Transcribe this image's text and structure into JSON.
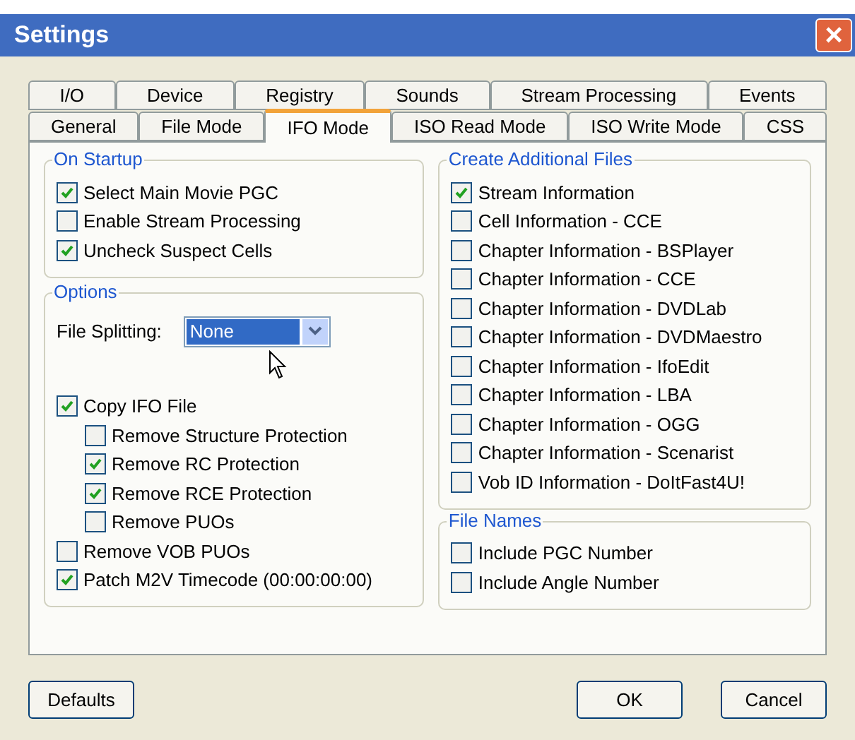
{
  "window": {
    "title": "Settings",
    "close": "×"
  },
  "tab_rows": [
    [
      {
        "label": "I/O",
        "selected": false
      },
      {
        "label": "Device",
        "selected": false
      },
      {
        "label": "Registry",
        "selected": false
      },
      {
        "label": "Sounds",
        "selected": false
      },
      {
        "label": "Stream Processing",
        "selected": false
      },
      {
        "label": "Events",
        "selected": false
      }
    ],
    [
      {
        "label": "General",
        "selected": false
      },
      {
        "label": "File Mode",
        "selected": false
      },
      {
        "label": "IFO Mode",
        "selected": true
      },
      {
        "label": "ISO Read Mode",
        "selected": false
      },
      {
        "label": "ISO Write Mode",
        "selected": false
      },
      {
        "label": "CSS",
        "selected": false
      }
    ]
  ],
  "on_startup": {
    "title": "On Startup",
    "items": [
      {
        "label": "Select Main Movie PGC",
        "checked": true
      },
      {
        "label": "Enable Stream Processing",
        "checked": false
      },
      {
        "label": "Uncheck Suspect Cells",
        "checked": true
      }
    ]
  },
  "options": {
    "title": "Options",
    "file_splitting": {
      "label": "File Splitting:",
      "value": "None"
    },
    "items": [
      {
        "label": "Copy IFO File",
        "checked": true,
        "children": [
          {
            "label": "Remove Structure Protection",
            "checked": false
          },
          {
            "label": "Remove RC Protection",
            "checked": true
          },
          {
            "label": "Remove RCE Protection",
            "checked": true
          },
          {
            "label": "Remove PUOs",
            "checked": false
          }
        ]
      },
      {
        "label": "Remove VOB PUOs",
        "checked": false
      },
      {
        "label": "Patch M2V Timecode (00:00:00:00)",
        "checked": true
      }
    ]
  },
  "create_additional_files": {
    "title": "Create Additional Files",
    "items": [
      {
        "label": "Stream Information",
        "checked": true
      },
      {
        "label": "Cell Information - CCE",
        "checked": false
      },
      {
        "label": "Chapter Information - BSPlayer",
        "checked": false
      },
      {
        "label": "Chapter Information - CCE",
        "checked": false
      },
      {
        "label": "Chapter Information - DVDLab",
        "checked": false
      },
      {
        "label": "Chapter Information - DVDMaestro",
        "checked": false
      },
      {
        "label": "Chapter Information - IfoEdit",
        "checked": false
      },
      {
        "label": "Chapter Information - LBA",
        "checked": false
      },
      {
        "label": "Chapter Information - OGG",
        "checked": false
      },
      {
        "label": "Chapter Information - Scenarist",
        "checked": false
      },
      {
        "label": "Vob ID Information - DoItFast4U!",
        "checked": false
      }
    ]
  },
  "file_names": {
    "title": "File Names",
    "items": [
      {
        "label": "Include PGC Number",
        "checked": false
      },
      {
        "label": "Include Angle Number",
        "checked": false
      }
    ]
  },
  "buttons": [
    {
      "label": "Defaults"
    },
    {
      "label": "OK"
    },
    {
      "label": "Cancel"
    }
  ]
}
